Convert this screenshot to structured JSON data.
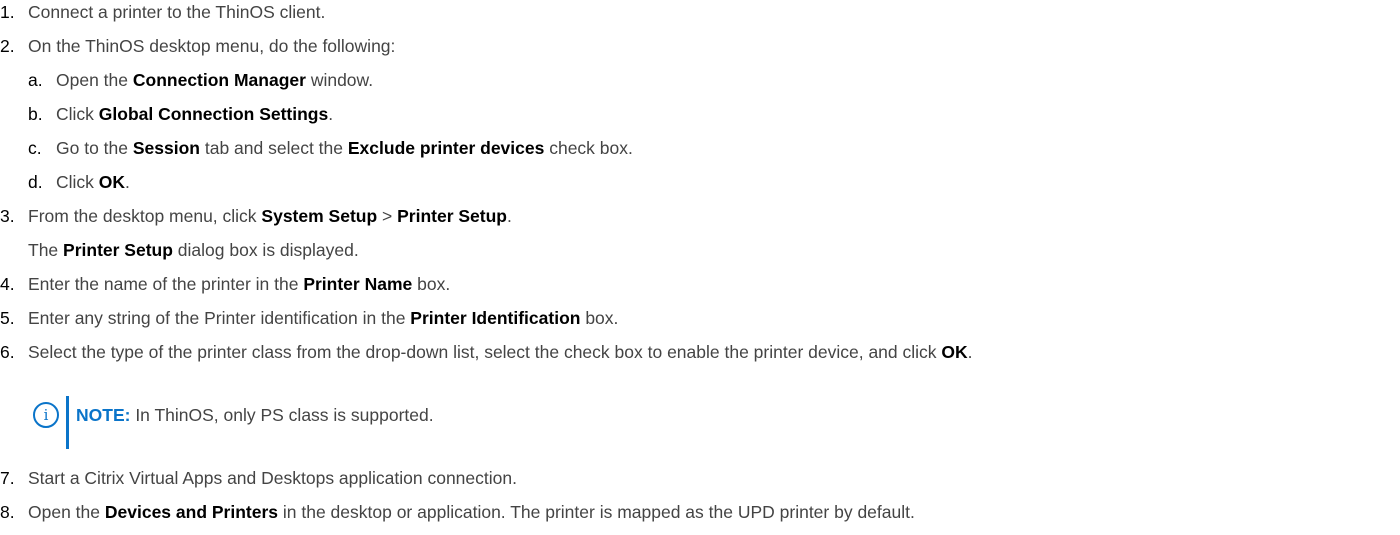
{
  "steps": [
    {
      "num": "1.",
      "parts": [
        {
          "t": "Connect a printer to the ThinOS client."
        }
      ]
    },
    {
      "num": "2.",
      "parts": [
        {
          "t": "On the ThinOS desktop menu, do the following:"
        }
      ]
    },
    {
      "num": "a.",
      "parts": [
        {
          "t": "Open the "
        },
        {
          "t": "Connection Manager",
          "b": true
        },
        {
          "t": " window."
        }
      ]
    },
    {
      "num": "b.",
      "parts": [
        {
          "t": "Click "
        },
        {
          "t": "Global Connection Settings",
          "b": true
        },
        {
          "t": "."
        }
      ]
    },
    {
      "num": "c.",
      "parts": [
        {
          "t": "Go to the "
        },
        {
          "t": "Session",
          "b": true
        },
        {
          "t": " tab and select the "
        },
        {
          "t": "Exclude printer devices",
          "b": true
        },
        {
          "t": " check box."
        }
      ]
    },
    {
      "num": "d.",
      "parts": [
        {
          "t": "Click "
        },
        {
          "t": "OK",
          "b": true
        },
        {
          "t": "."
        }
      ]
    },
    {
      "num": "3.",
      "parts": [
        {
          "t": "From the desktop menu, click "
        },
        {
          "t": "System Setup",
          "b": true
        },
        {
          "t": " > "
        },
        {
          "t": "Printer Setup",
          "b": true
        },
        {
          "t": "."
        }
      ]
    },
    {
      "num": "",
      "parts": [
        {
          "t": "The "
        },
        {
          "t": "Printer Setup",
          "b": true
        },
        {
          "t": " dialog box is displayed."
        }
      ]
    },
    {
      "num": "4.",
      "parts": [
        {
          "t": "Enter the name of the printer in the "
        },
        {
          "t": "Printer Name",
          "b": true
        },
        {
          "t": " box."
        }
      ]
    },
    {
      "num": "5.",
      "parts": [
        {
          "t": "Enter any string of the Printer identification in the "
        },
        {
          "t": "Printer Identification",
          "b": true
        },
        {
          "t": " box."
        }
      ]
    },
    {
      "num": "6.",
      "parts": [
        {
          "t": "Select the type of the printer class from the drop-down list, select the check box to enable the printer device, and click "
        },
        {
          "t": "OK",
          "b": true
        },
        {
          "t": "."
        }
      ]
    },
    {
      "num": "7.",
      "parts": [
        {
          "t": "Start a Citrix Virtual Apps and Desktops application connection."
        }
      ]
    },
    {
      "num": "8.",
      "parts": [
        {
          "t": "Open the "
        },
        {
          "t": "Devices and Printers",
          "b": true
        },
        {
          "t": " in the desktop or application. The printer is mapped as the UPD printer by default."
        }
      ]
    }
  ],
  "note": {
    "icon": "info-icon",
    "icon_glyph": "i",
    "label": "NOTE:",
    "text": " In ThinOS, only PS class is supported.",
    "accent_color": "#0a74c9"
  }
}
